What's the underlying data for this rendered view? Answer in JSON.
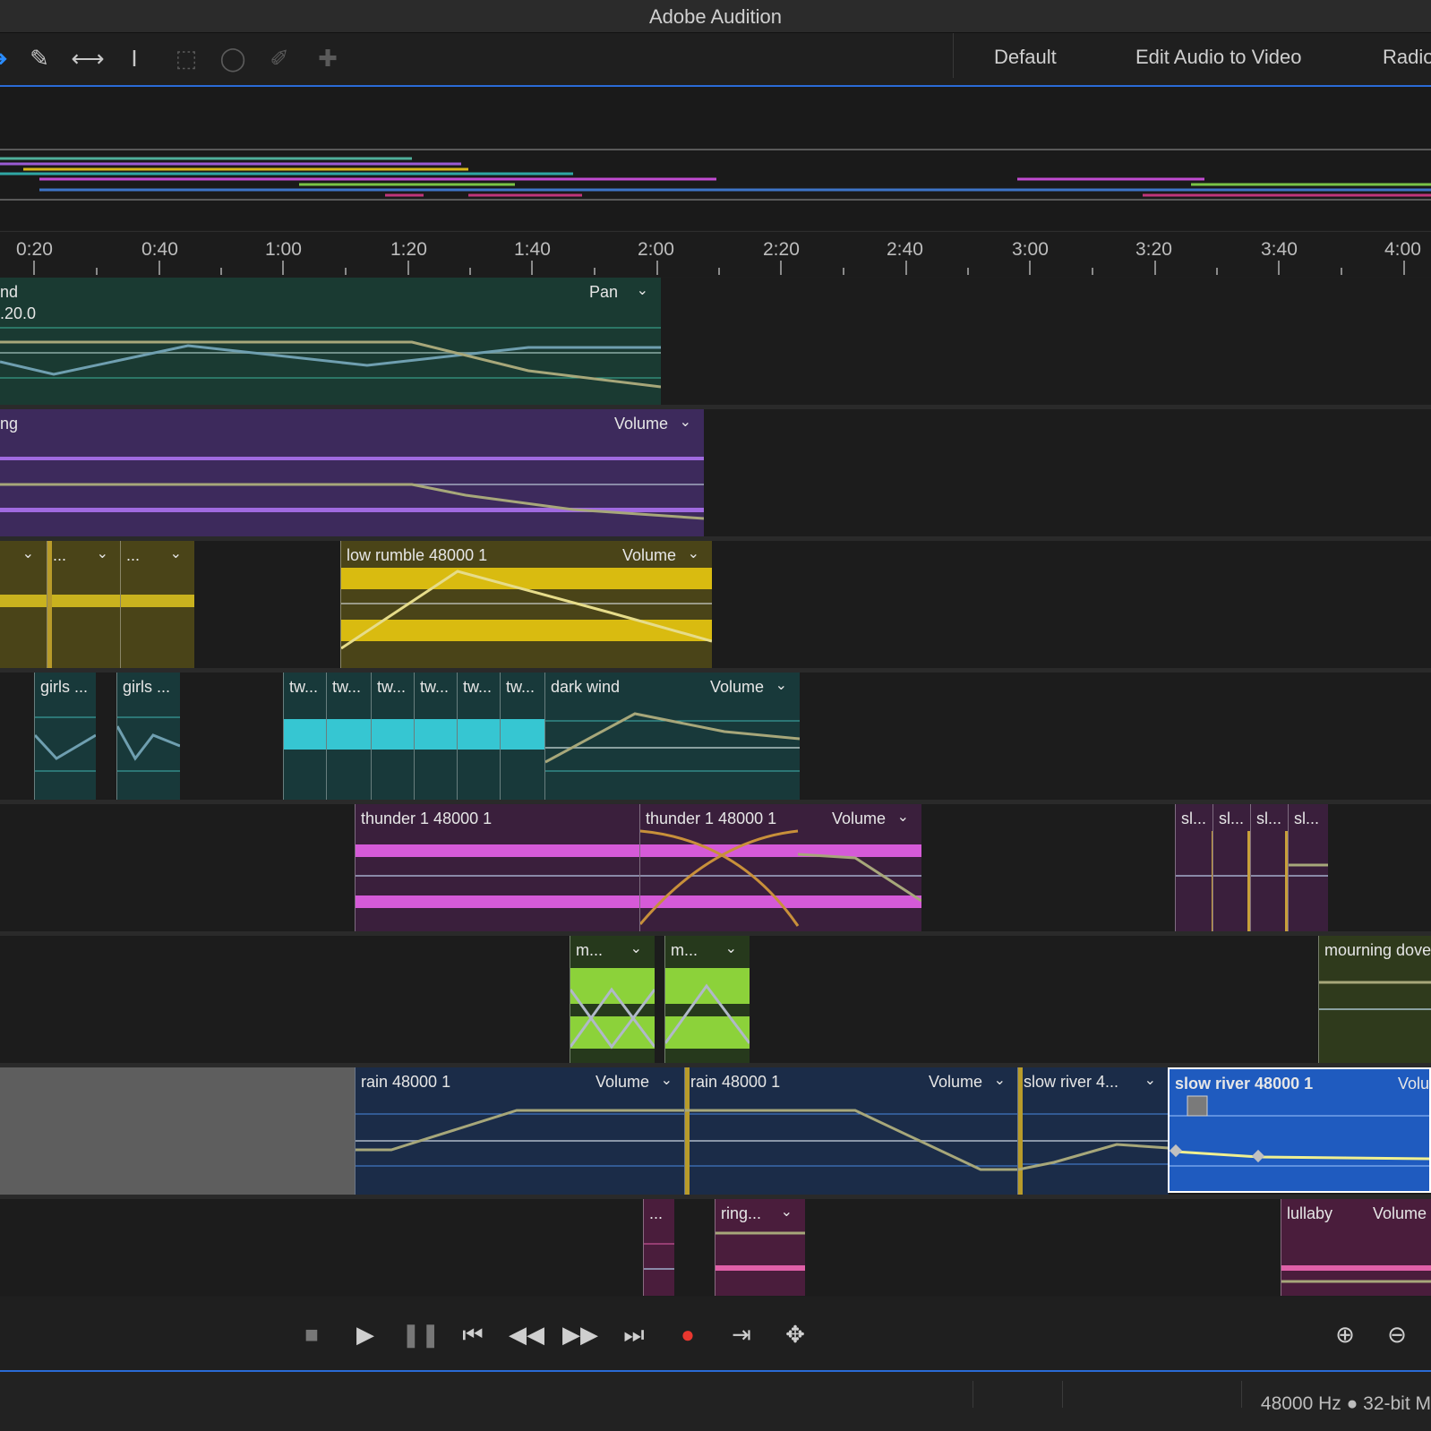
{
  "app": {
    "title": "Adobe Audition"
  },
  "workspaces": [
    "Default",
    "Edit Audio to Video",
    "Radio"
  ],
  "ruler": {
    "labels": [
      "0:20",
      "0:40",
      "1:00",
      "1:20",
      "1:40",
      "2:00",
      "2:20",
      "2:40",
      "3:00",
      "3:20",
      "3:40",
      "4:00"
    ]
  },
  "tracks": [
    {
      "clips": [
        {
          "name": "nd",
          "sub": ".20.0",
          "kf": "Pan"
        }
      ]
    },
    {
      "clips": [
        {
          "name": "ng",
          "kf": "Volume"
        }
      ]
    },
    {
      "clips": [
        {
          "name": "",
          "kf": ""
        },
        {
          "name": "...",
          "kf": ""
        },
        {
          "name": "...",
          "kf": ""
        },
        {
          "name": "low rumble 48000 1",
          "kf": "Volume"
        }
      ]
    },
    {
      "clips": [
        {
          "name": "girls ...",
          "kf": ""
        },
        {
          "name": "girls ...",
          "kf": ""
        },
        {
          "name": "tw...",
          "kf": ""
        },
        {
          "name": "tw...",
          "kf": ""
        },
        {
          "name": "tw...",
          "kf": ""
        },
        {
          "name": "tw...",
          "kf": ""
        },
        {
          "name": "tw...",
          "kf": ""
        },
        {
          "name": "tw...",
          "kf": ""
        },
        {
          "name": "dark wind",
          "kf": "Volume"
        }
      ]
    },
    {
      "clips": [
        {
          "name": "thunder 1 48000 1",
          "kf": ""
        },
        {
          "name": "thunder 1 48000 1",
          "kf": "Volume"
        },
        {
          "name": "sl...",
          "kf": ""
        },
        {
          "name": "sl...",
          "kf": ""
        },
        {
          "name": "sl...",
          "kf": ""
        },
        {
          "name": "sl...",
          "kf": ""
        }
      ]
    },
    {
      "clips": [
        {
          "name": "m...",
          "kf": ""
        },
        {
          "name": "m...",
          "kf": ""
        },
        {
          "name": "mourning dove",
          "kf": ""
        }
      ]
    },
    {
      "clips": [
        {
          "name": "rain 48000 1",
          "kf": "Volume"
        },
        {
          "name": "rain 48000 1",
          "kf": "Volume"
        },
        {
          "name": "slow river 4...",
          "kf": ""
        },
        {
          "name": "slow river 48000 1",
          "kf": "Volu"
        }
      ]
    },
    {
      "clips": [
        {
          "name": "...",
          "kf": ""
        },
        {
          "name": "ring...",
          "kf": ""
        },
        {
          "name": "lullaby",
          "kf": "Volume"
        }
      ]
    }
  ],
  "status": {
    "text": "48000 Hz ● 32-bit M"
  },
  "colors": {
    "accent": "#2a6bd6",
    "record": "#e8372f"
  }
}
